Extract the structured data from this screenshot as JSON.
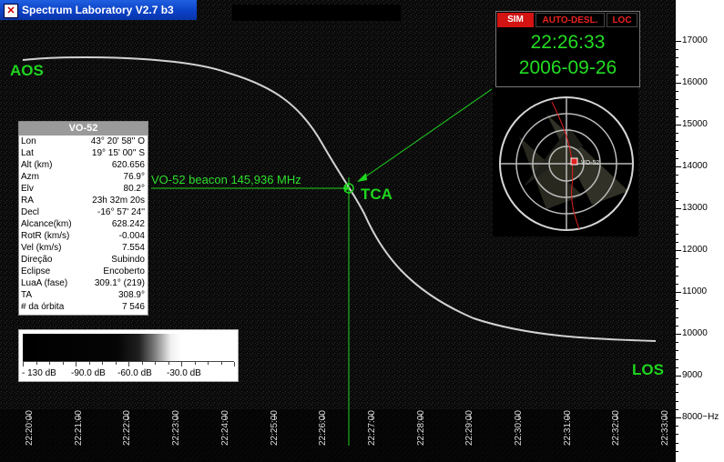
{
  "window": {
    "title": "Spectrum Laboratory V2.7 b3",
    "icon": "app-icon"
  },
  "labels": {
    "aos": "AOS",
    "tca": "TCA",
    "los": "LOS",
    "beacon": "VO-52 beacon 145,936 MHz"
  },
  "satellite_panel": {
    "title": "VO-52",
    "rows": [
      {
        "key": "Lon",
        "value": "43° 20' 58'' O"
      },
      {
        "key": "Lat",
        "value": "19° 15' 00'' S"
      },
      {
        "key": "Alt (km)",
        "value": "620.656"
      },
      {
        "key": "Azm",
        "value": "76.9°"
      },
      {
        "key": "Elv",
        "value": "80.2°"
      },
      {
        "key": "RA",
        "value": "23h 32m 20s"
      },
      {
        "key": "Decl",
        "value": "-16° 57' 24''"
      },
      {
        "key": "Alcance(km)",
        "value": "628.242"
      },
      {
        "key": "RotR (km/s)",
        "value": "-0.004"
      },
      {
        "key": "Vel (km/s)",
        "value": "7.554"
      },
      {
        "key": "Direção",
        "value": "Subindo"
      },
      {
        "key": "Eclipse",
        "value": "Encoberto"
      },
      {
        "key": "LuaA (fase)",
        "value": "309.1° (219)"
      },
      {
        "key": "TA",
        "value": "308.9°"
      },
      {
        "key": "# da órbita",
        "value": "7 546"
      }
    ]
  },
  "db_scale": {
    "labels": [
      "- 130 dB",
      "-90.0 dB",
      "-60.0 dB",
      "-30.0 dB"
    ]
  },
  "clock": {
    "tabs": {
      "sim": "SIM",
      "auto": "AUTO-DESL.",
      "loc": "LOC"
    },
    "time": "22:26:33",
    "date": "2006-09-26"
  },
  "polar_plot": {
    "satellite_label": "VO-52"
  },
  "frequency_axis": {
    "labels": [
      "17000",
      "16000",
      "15000",
      "14000",
      "13000",
      "12000",
      "11000",
      "10000",
      "9000",
      "8000~Hz"
    ]
  },
  "time_axis": {
    "labels": [
      "22:20:00",
      "22:21:00",
      "22:22:00",
      "22:23:00",
      "22:24:00",
      "22:25:00",
      "22:26:00",
      "22:27:00",
      "22:28:00",
      "22:29:00",
      "22:30:00",
      "22:31:00",
      "22:32:00",
      "22:33:00"
    ]
  },
  "colors": {
    "label_green": "#1ed51e",
    "sim_red": "#d41313",
    "trace": "#e8e8e8"
  }
}
